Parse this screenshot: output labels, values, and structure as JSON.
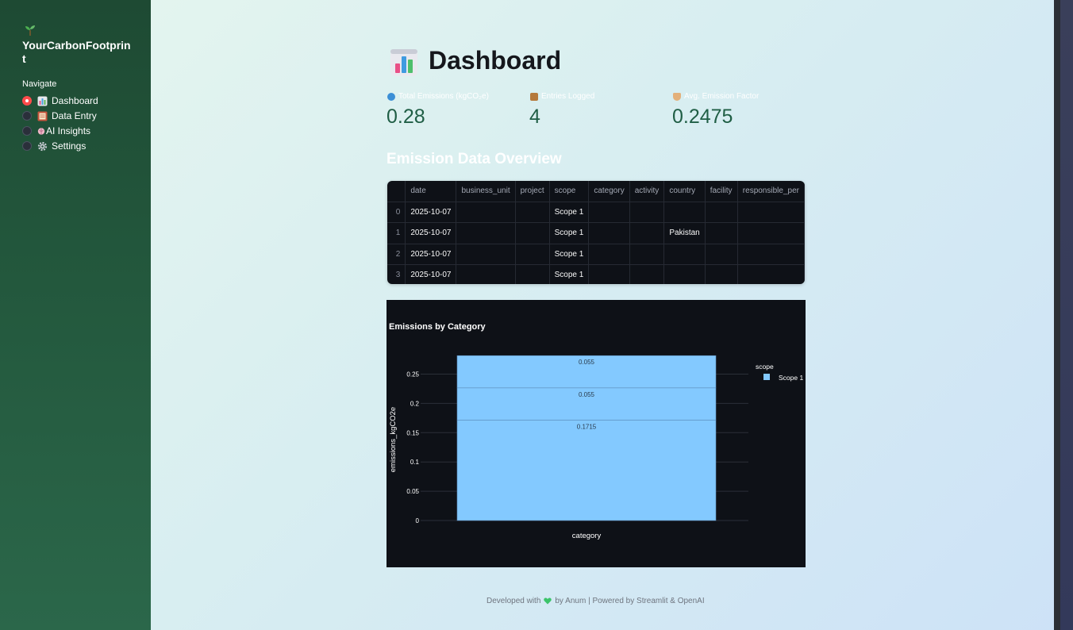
{
  "sidebar": {
    "brand": "YourCarbonFootprint",
    "brand_icon": "seedling-icon",
    "nav_label": "Navigate",
    "items": [
      {
        "label": "Dashboard",
        "icon": "bar-chart-icon",
        "selected": true
      },
      {
        "label": "Data Entry",
        "icon": "notebook-icon",
        "selected": false
      },
      {
        "label": "AI Insights",
        "icon": "brain-icon",
        "selected": false
      },
      {
        "label": "Settings",
        "icon": "gear-icon",
        "selected": false
      }
    ]
  },
  "header": {
    "title": "Dashboard",
    "icon": "bar-chart-icon"
  },
  "metrics": [
    {
      "label": "Total Emissions (kgCO₂e)",
      "value": "0.28",
      "icon": "globe-icon"
    },
    {
      "label": "Entries Logged",
      "value": "4",
      "icon": "package-icon"
    },
    {
      "label": "Avg. Emission Factor",
      "value": "0.2475",
      "icon": "bowl-icon"
    }
  ],
  "section_title": "Emission Data Overview",
  "table": {
    "columns": [
      "",
      "date",
      "business_unit",
      "project",
      "scope",
      "category",
      "activity",
      "country",
      "facility",
      "responsible_per"
    ],
    "rows": [
      [
        "0",
        "2025-10-07",
        "",
        "",
        "Scope 1",
        "",
        "",
        "",
        "",
        ""
      ],
      [
        "1",
        "2025-10-07",
        "",
        "",
        "Scope 1",
        "",
        "",
        "Pakistan",
        "",
        ""
      ],
      [
        "2",
        "2025-10-07",
        "",
        "",
        "Scope 1",
        "",
        "",
        "",
        "",
        ""
      ],
      [
        "3",
        "2025-10-07",
        "",
        "",
        "Scope 1",
        "",
        "",
        "",
        "",
        ""
      ]
    ]
  },
  "chart_data": {
    "type": "bar",
    "title": "Emissions by Category",
    "xlabel": "category",
    "ylabel": "emissions_kgCO2e",
    "categories": [
      ""
    ],
    "series": [
      {
        "name": "Scope 1",
        "segments": [
          0.1715,
          0.055,
          0.055
        ],
        "color": "#83c9ff"
      }
    ],
    "segment_labels": [
      "0.1715",
      "0.055",
      "0.055"
    ],
    "ylim": [
      0,
      0.2818
    ],
    "yticks": [
      0,
      0.05,
      0.1,
      0.15,
      0.2,
      0.25
    ],
    "ytick_labels": [
      "0",
      "0.05",
      "0.1",
      "0.15",
      "0.2",
      "0.25"
    ],
    "legend": {
      "title": "scope",
      "position": "top-right"
    },
    "grid": true
  },
  "footer": {
    "before": "Developed with",
    "after": "by Anum | Powered by Streamlit & OpenAI"
  },
  "colors": {
    "accent": "#ff4b4b",
    "metric_value": "#1f5e45",
    "bar": "#83c9ff"
  }
}
